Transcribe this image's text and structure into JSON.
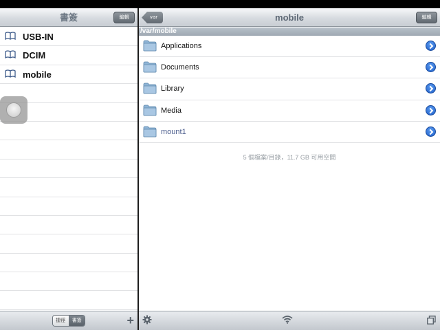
{
  "left": {
    "nav_title": "書簽",
    "edit_label": "編輯",
    "bookmarks": [
      {
        "label": "USB-IN",
        "icon": "book-icon"
      },
      {
        "label": "DCIM",
        "icon": "book-icon"
      },
      {
        "label": "mobile",
        "icon": "book-icon"
      }
    ],
    "toolbar": {
      "segment_history": "捷徑",
      "segment_bookmarks": "書簽",
      "add_icon": "plus-icon"
    }
  },
  "right": {
    "nav_title": "mobile",
    "back_label": "var",
    "edit_label": "編輯",
    "path": "/var/mobile",
    "files": [
      {
        "name": "Applications",
        "icon": "folder-icon"
      },
      {
        "name": "Documents",
        "icon": "folder-icon"
      },
      {
        "name": "Library",
        "icon": "folder-icon"
      },
      {
        "name": "Media",
        "icon": "folder-icon"
      },
      {
        "name": "mount1",
        "icon": "folder-icon"
      }
    ],
    "summary": "5 個檔案/目錄，11.7 GB 可用空間",
    "toolbar": {
      "settings_icon": "gear-icon",
      "wifi_icon": "wifi-icon",
      "windows_icon": "windows-icon"
    }
  },
  "colors": {
    "disclosure_blue": "#1e5ec9",
    "path_bar": "#a8b2bc",
    "link_text": "#4a5c8c"
  }
}
